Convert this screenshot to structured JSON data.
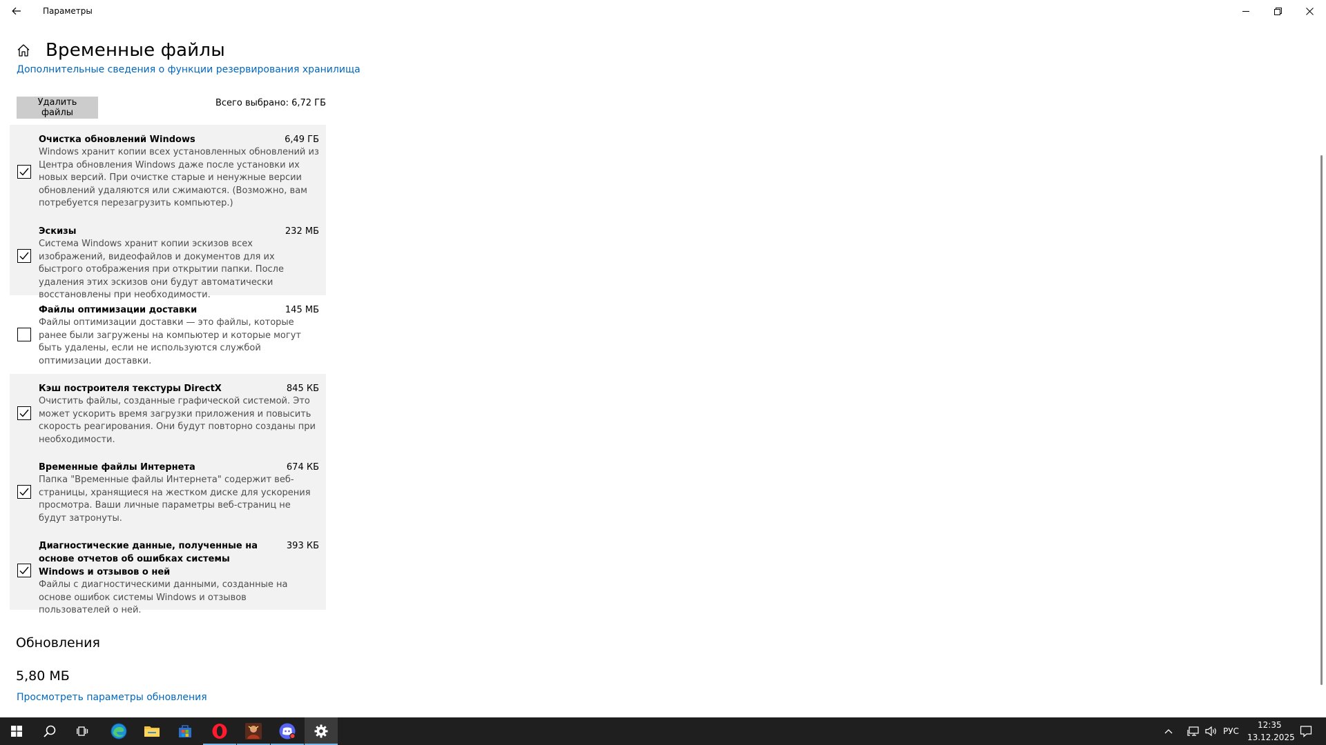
{
  "window": {
    "title": "Параметры"
  },
  "page": {
    "title": "Временные файлы",
    "more_link": "Дополнительные сведения о функции резервирования хранилища",
    "delete_button": "Удалить файлы",
    "total_selected": "Всего выбрано: 6,72 ГБ"
  },
  "items": [
    {
      "name": "Очистка обновлений Windows",
      "size": "6,49 ГБ",
      "checked": true,
      "desc": "Windows хранит копии всех установленных обновлений из Центра обновления Windows даже после установки их новых версий. При очистке старые и ненужные версии обновлений удаляются или сжимаются. (Возможно, вам потребуется перезагрузить компьютер.)"
    },
    {
      "name": "Эскизы",
      "size": "232 МБ",
      "checked": true,
      "desc": "Система Windows хранит копии эскизов всех изображений, видеофайлов и документов для их быстрого отображения при открытии папки. После удаления этих эскизов они будут автоматически восстановлены при необходимости."
    },
    {
      "name": "Файлы оптимизации доставки",
      "size": "145 МБ",
      "checked": false,
      "desc": "Файлы оптимизации доставки — это файлы, которые ранее были загружены на компьютер и которые могут быть удалены, если не используются службой оптимизации доставки."
    },
    {
      "name": "Кэш построителя текстуры DirectX",
      "size": "845 КБ",
      "checked": true,
      "desc": "Очистить файлы, созданные графической системой. Это может ускорить время загрузки приложения и повысить скорость реагирования. Они будут повторно созданы при необходимости."
    },
    {
      "name": "Временные файлы Интернета",
      "size": "674 КБ",
      "checked": true,
      "desc": "Папка \"Временные файлы Интернета\" содержит веб-страницы, хранящиеся на жестком диске для ускорения просмотра. Ваши личные параметры веб-страниц не будут затронуты."
    },
    {
      "name": "Диагностические данные, полученные на основе отчетов об ошибках системы Windows и отзывов о ней",
      "size": "393 КБ",
      "checked": true,
      "desc": "Файлы с диагностическими данными, созданные на основе ошибок системы Windows и отзывов пользователей о ней."
    }
  ],
  "updates": {
    "title": "Обновления",
    "size": "5,80 МБ",
    "link": "Просмотреть параметры обновления"
  },
  "taskbar": {
    "apps": [
      "start-icon",
      "search-icon",
      "task-view-icon",
      "edge-icon",
      "file-explorer-icon",
      "store-icon",
      "opera-icon",
      "game-icon",
      "discord-icon",
      "settings-icon"
    ],
    "language": "РУС",
    "time": "12:35",
    "date": "13.12.2025",
    "accent": "#76b9ed"
  },
  "colors": {
    "link": "#0067c0",
    "taskbar": "#1f1f1f",
    "item_alt_bg": "#f2f2f2",
    "button_bg": "#cccccc"
  }
}
